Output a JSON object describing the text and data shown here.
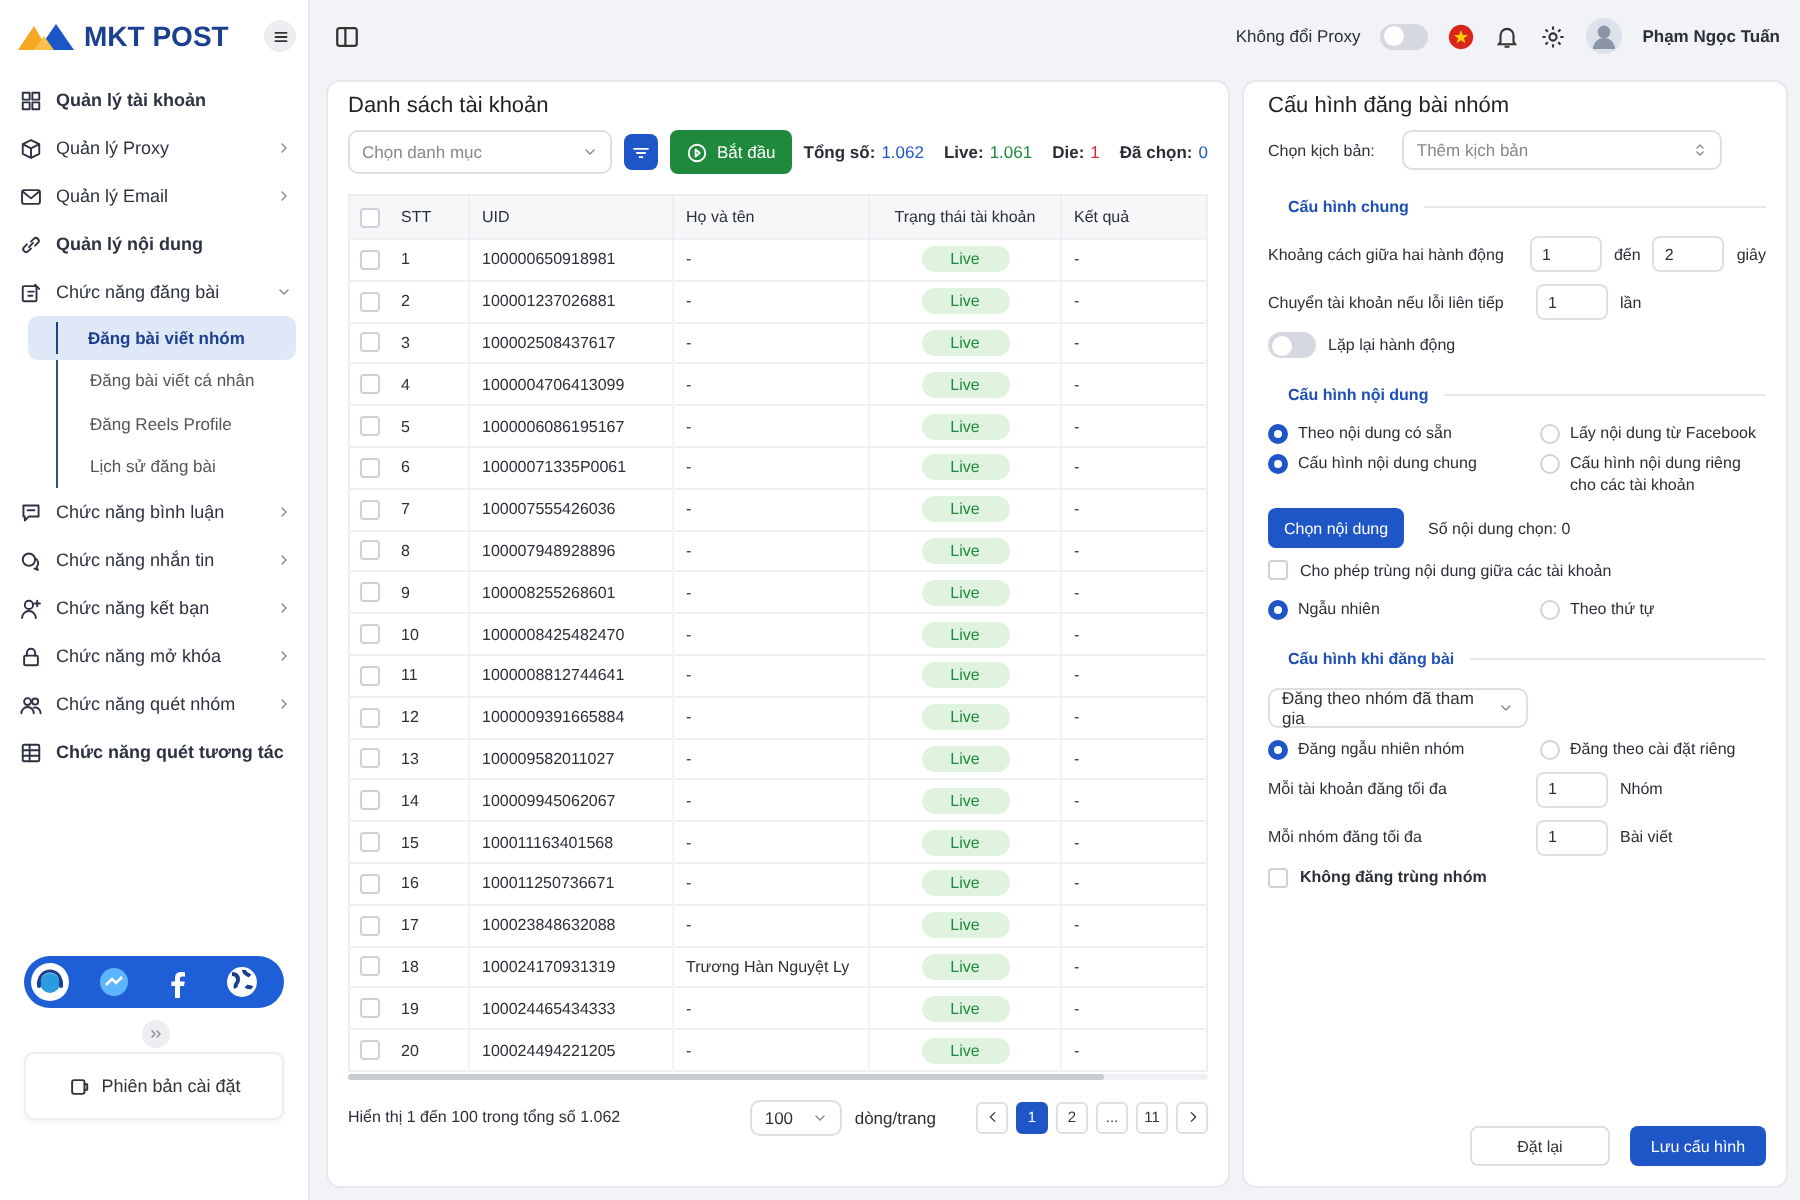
{
  "app": {
    "logo": "MKT POST"
  },
  "topbar": {
    "proxy_label": "Không đổi Proxy",
    "proxy_on": false,
    "user_name": "Phạm Ngọc Tuấn"
  },
  "sidebar": {
    "items": [
      {
        "kind": "link",
        "label": "Quản lý tài khoản"
      },
      {
        "kind": "group",
        "label": "Quản lý Proxy",
        "expanded": false
      },
      {
        "kind": "group",
        "label": "Quản lý Email",
        "expanded": false
      },
      {
        "kind": "link",
        "label": "Quản lý nội dung"
      },
      {
        "kind": "group",
        "label": "Chức năng đăng bài",
        "expanded": true,
        "children": [
          {
            "label": "Đăng bài viết nhóm",
            "selected": true
          },
          {
            "label": "Đăng bài viết cá nhân",
            "selected": false
          },
          {
            "label": "Đăng Reels Profile",
            "selected": false
          },
          {
            "label": "Lịch sử đăng bài",
            "selected": false
          }
        ]
      },
      {
        "kind": "group",
        "label": "Chức năng bình luận",
        "expanded": false
      },
      {
        "kind": "group",
        "label": "Chức năng nhắn tin",
        "expanded": false
      },
      {
        "kind": "group",
        "label": "Chức năng kết bạn",
        "expanded": false
      },
      {
        "kind": "group",
        "label": "Chức năng mở khóa",
        "expanded": false
      },
      {
        "kind": "group",
        "label": "Chức năng quét nhóm",
        "expanded": false
      },
      {
        "kind": "link",
        "label": "Chức năng quét tương tác"
      }
    ],
    "version_label": "Phiên bản cài đặt"
  },
  "accounts": {
    "title": "Danh sách tài khoản",
    "category_placeholder": "Chọn danh mục",
    "start_button": "Bắt đầu",
    "stats": [
      {
        "label": "Tổng số:",
        "value": "1.062",
        "color": "#1e56c8"
      },
      {
        "label": "Live:",
        "value": "1.061",
        "color": "#1f8a3b"
      },
      {
        "label": "Die:",
        "value": "1",
        "color": "#d32f2f"
      },
      {
        "label": "Đã chọn:",
        "value": "0",
        "color": "#1e56c8"
      }
    ],
    "table": {
      "all_checked": false,
      "columns": [
        "STT",
        "UID",
        "Họ và tên",
        "Trạng thái tài khoản",
        "Kết quả"
      ],
      "rows": [
        {
          "stt": "1",
          "uid": "100000650918981",
          "name": "-",
          "status": "Live",
          "result": "-",
          "checked": false
        },
        {
          "stt": "2",
          "uid": "100001237026881",
          "name": "-",
          "status": "Live",
          "result": "-",
          "checked": false
        },
        {
          "stt": "3",
          "uid": "100002508437617",
          "name": "-",
          "status": "Live",
          "result": "-",
          "checked": false
        },
        {
          "stt": "4",
          "uid": "1000004706413099",
          "name": "-",
          "status": "Live",
          "result": "-",
          "checked": false
        },
        {
          "stt": "5",
          "uid": "1000006086195167",
          "name": "-",
          "status": "Live",
          "result": "-",
          "checked": false
        },
        {
          "stt": "6",
          "uid": "10000071335P0061",
          "name": "-",
          "status": "Live",
          "result": "-",
          "checked": false
        },
        {
          "stt": "7",
          "uid": "100007555426036",
          "name": "-",
          "status": "Live",
          "result": "-",
          "checked": false
        },
        {
          "stt": "8",
          "uid": "100007948928896",
          "name": "-",
          "status": "Live",
          "result": "-",
          "checked": false
        },
        {
          "stt": "9",
          "uid": "100008255268601",
          "name": "-",
          "status": "Live",
          "result": "-",
          "checked": false
        },
        {
          "stt": "10",
          "uid": "1000008425482470",
          "name": "-",
          "status": "Live",
          "result": "-",
          "checked": false
        },
        {
          "stt": "11",
          "uid": "1000008812744641",
          "name": "-",
          "status": "Live",
          "result": "-",
          "checked": false
        },
        {
          "stt": "12",
          "uid": "1000009391665884",
          "name": "-",
          "status": "Live",
          "result": "-",
          "checked": false
        },
        {
          "stt": "13",
          "uid": "100009582011027",
          "name": "-",
          "status": "Live",
          "result": "-",
          "checked": false
        },
        {
          "stt": "14",
          "uid": "100009945062067",
          "name": "-",
          "status": "Live",
          "result": "-",
          "checked": false
        },
        {
          "stt": "15",
          "uid": "100011163401568",
          "name": "-",
          "status": "Live",
          "result": "-",
          "checked": false
        },
        {
          "stt": "16",
          "uid": "100011250736671",
          "name": "-",
          "status": "Live",
          "result": "-",
          "checked": false
        },
        {
          "stt": "17",
          "uid": "100023848632088",
          "name": "-",
          "status": "Live",
          "result": "-",
          "checked": false
        },
        {
          "stt": "18",
          "uid": "100024170931319",
          "name": "Trương Hàn Nguyệt Ly",
          "status": "Live",
          "result": "-",
          "checked": false
        },
        {
          "stt": "19",
          "uid": "100024465434333",
          "name": "-",
          "status": "Live",
          "result": "-",
          "checked": false
        },
        {
          "stt": "20",
          "uid": "100024494221205",
          "name": "-",
          "status": "Live",
          "result": "-",
          "checked": false
        }
      ]
    },
    "footer": {
      "summary": "Hiển thị 1 đến 100 trong tổng số 1.062",
      "page_size": "100",
      "page_size_label": "dòng/trang",
      "pages": [
        {
          "label": "1",
          "selected": true
        },
        {
          "label": "2",
          "selected": false
        },
        {
          "label": "...",
          "selected": false
        },
        {
          "label": "11",
          "selected": false
        }
      ]
    }
  },
  "config": {
    "title": "Cấu hình đăng bài nhóm",
    "script_label": "Chọn kịch bản:",
    "script_placeholder": "Thêm kịch bản",
    "general": {
      "title": "Cấu hình chung",
      "delay_label": "Khoảng cách giữa hai hành động",
      "delay_from": "1",
      "delay_to_label": "đến",
      "delay_to": "2",
      "delay_unit": "giây",
      "switch_label": "Chuyển tài khoản nếu lỗi liên tiếp",
      "switch_value": "1",
      "switch_unit": "lần",
      "repeat_label": "Lặp lại hành động",
      "repeat_on": false
    },
    "content": {
      "title": "Cấu hình nội dung",
      "source_options": [
        {
          "label": "Theo nội dung có sẵn",
          "selected": true
        },
        {
          "label": "Lấy nội dung từ Facebook",
          "selected": false
        }
      ],
      "mode_options": [
        {
          "label": "Cấu hình nội dung chung",
          "selected": true
        },
        {
          "label": "Cấu hình nội dung riêng cho các tài khoản",
          "selected": false
        }
      ],
      "choose_button": "Chọn nội dung",
      "count_label": "Số nội dung chọn: 0",
      "allow_duplicate": {
        "label": "Cho phép trùng nội dung giữa các tài khoản",
        "checked": false
      },
      "order_options": [
        {
          "label": "Ngẫu nhiên",
          "selected": true
        },
        {
          "label": "Theo thứ tự",
          "selected": false
        }
      ]
    },
    "posting": {
      "title": "Cấu hình khi đăng bài",
      "target": "Đăng theo nhóm đã tham gia",
      "group_options": [
        {
          "label": "Đăng ngẫu nhiên nhóm",
          "selected": true
        },
        {
          "label": "Đăng theo cài đặt riêng",
          "selected": false
        }
      ],
      "per_account_label": "Mỗi tài khoản đăng tối đa",
      "per_account": "1",
      "per_account_unit": "Nhóm",
      "per_group_label": "Mỗi nhóm đăng tối đa",
      "per_group": "1",
      "per_group_unit": "Bài viết",
      "no_duplicate": {
        "label": "Không đăng trùng nhóm",
        "checked": false
      }
    },
    "buttons": {
      "reset": "Đặt lại",
      "save": "Lưu cấu hình"
    }
  }
}
